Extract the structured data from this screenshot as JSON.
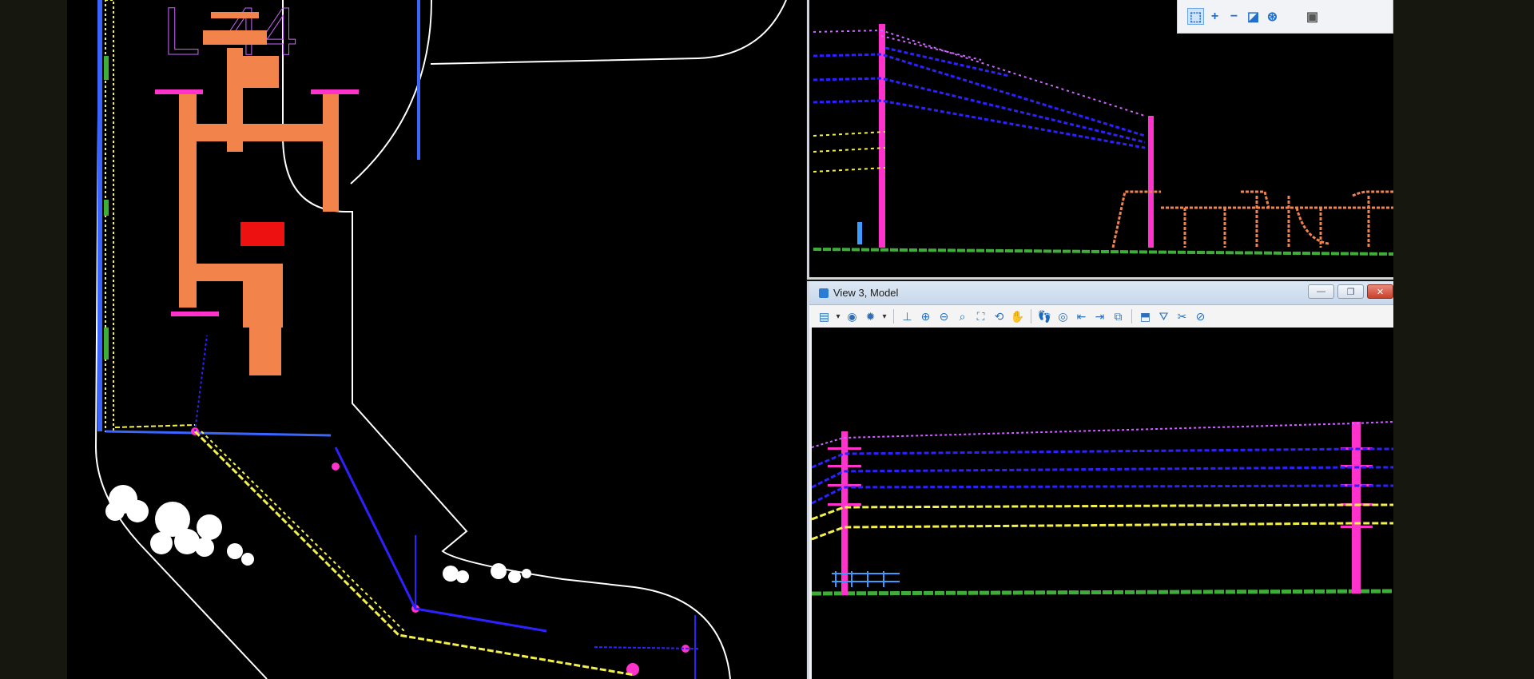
{
  "plan_view": {
    "label_text": "L-44"
  },
  "top_toolbar": {
    "tools": [
      {
        "icon": "select-element-icon",
        "glyph": "⬚",
        "active": true
      },
      {
        "icon": "add-icon",
        "glyph": "+"
      },
      {
        "icon": "subtract-icon",
        "glyph": "−"
      },
      {
        "icon": "invert-icon",
        "glyph": "◪"
      },
      {
        "icon": "target-icon",
        "glyph": "⊛"
      },
      {
        "icon": "selection-mode-icon",
        "glyph": "▣"
      }
    ]
  },
  "view3": {
    "title": "View 3, Model",
    "window_buttons": {
      "minimize": "—",
      "restore": "❐",
      "close": "✕"
    },
    "tools": [
      "view-attributes-icon",
      "chevron-down-icon",
      "display-style-icon",
      "lighting-icon",
      "chevron-down-icon",
      "separator",
      "brush-icon",
      "zoom-in-icon",
      "zoom-out-icon",
      "zoom-window-icon",
      "fit-view-icon",
      "rotate-view-icon",
      "pan-view-icon",
      "separator",
      "walk-icon",
      "camera-icon",
      "view-previous-icon",
      "view-next-icon",
      "copy-view-icon",
      "separator",
      "window-area-icon",
      "clip-volume-icon",
      "clip-mask-icon",
      "toggle-clip-icon"
    ],
    "tool_glyphs": {
      "view-attributes-icon": "▤",
      "chevron-down-icon": "▾",
      "display-style-icon": "◉",
      "lighting-icon": "✹",
      "brush-icon": "⊥",
      "zoom-in-icon": "⊕",
      "zoom-out-icon": "⊖",
      "zoom-window-icon": "⌕",
      "fit-view-icon": "⛶",
      "rotate-view-icon": "⟲",
      "pan-view-icon": "✋",
      "walk-icon": "👣",
      "camera-icon": "◎",
      "view-previous-icon": "⇤",
      "view-next-icon": "⇥",
      "copy-view-icon": "⧉",
      "window-area-icon": "⬒",
      "clip-volume-icon": "⛛",
      "clip-mask-icon": "✂",
      "toggle-clip-icon": "⊘"
    }
  },
  "colors": {
    "background": "#000000",
    "boundary": "#ffffff",
    "equipment": "#f2834b",
    "label": "#cc66ff",
    "wire_blue": "#2d22ff",
    "wire_yellow": "#f4f04a",
    "pole_magenta": "#ff33cc",
    "ground_green": "#3fae38",
    "red_object": "#ee1111"
  }
}
